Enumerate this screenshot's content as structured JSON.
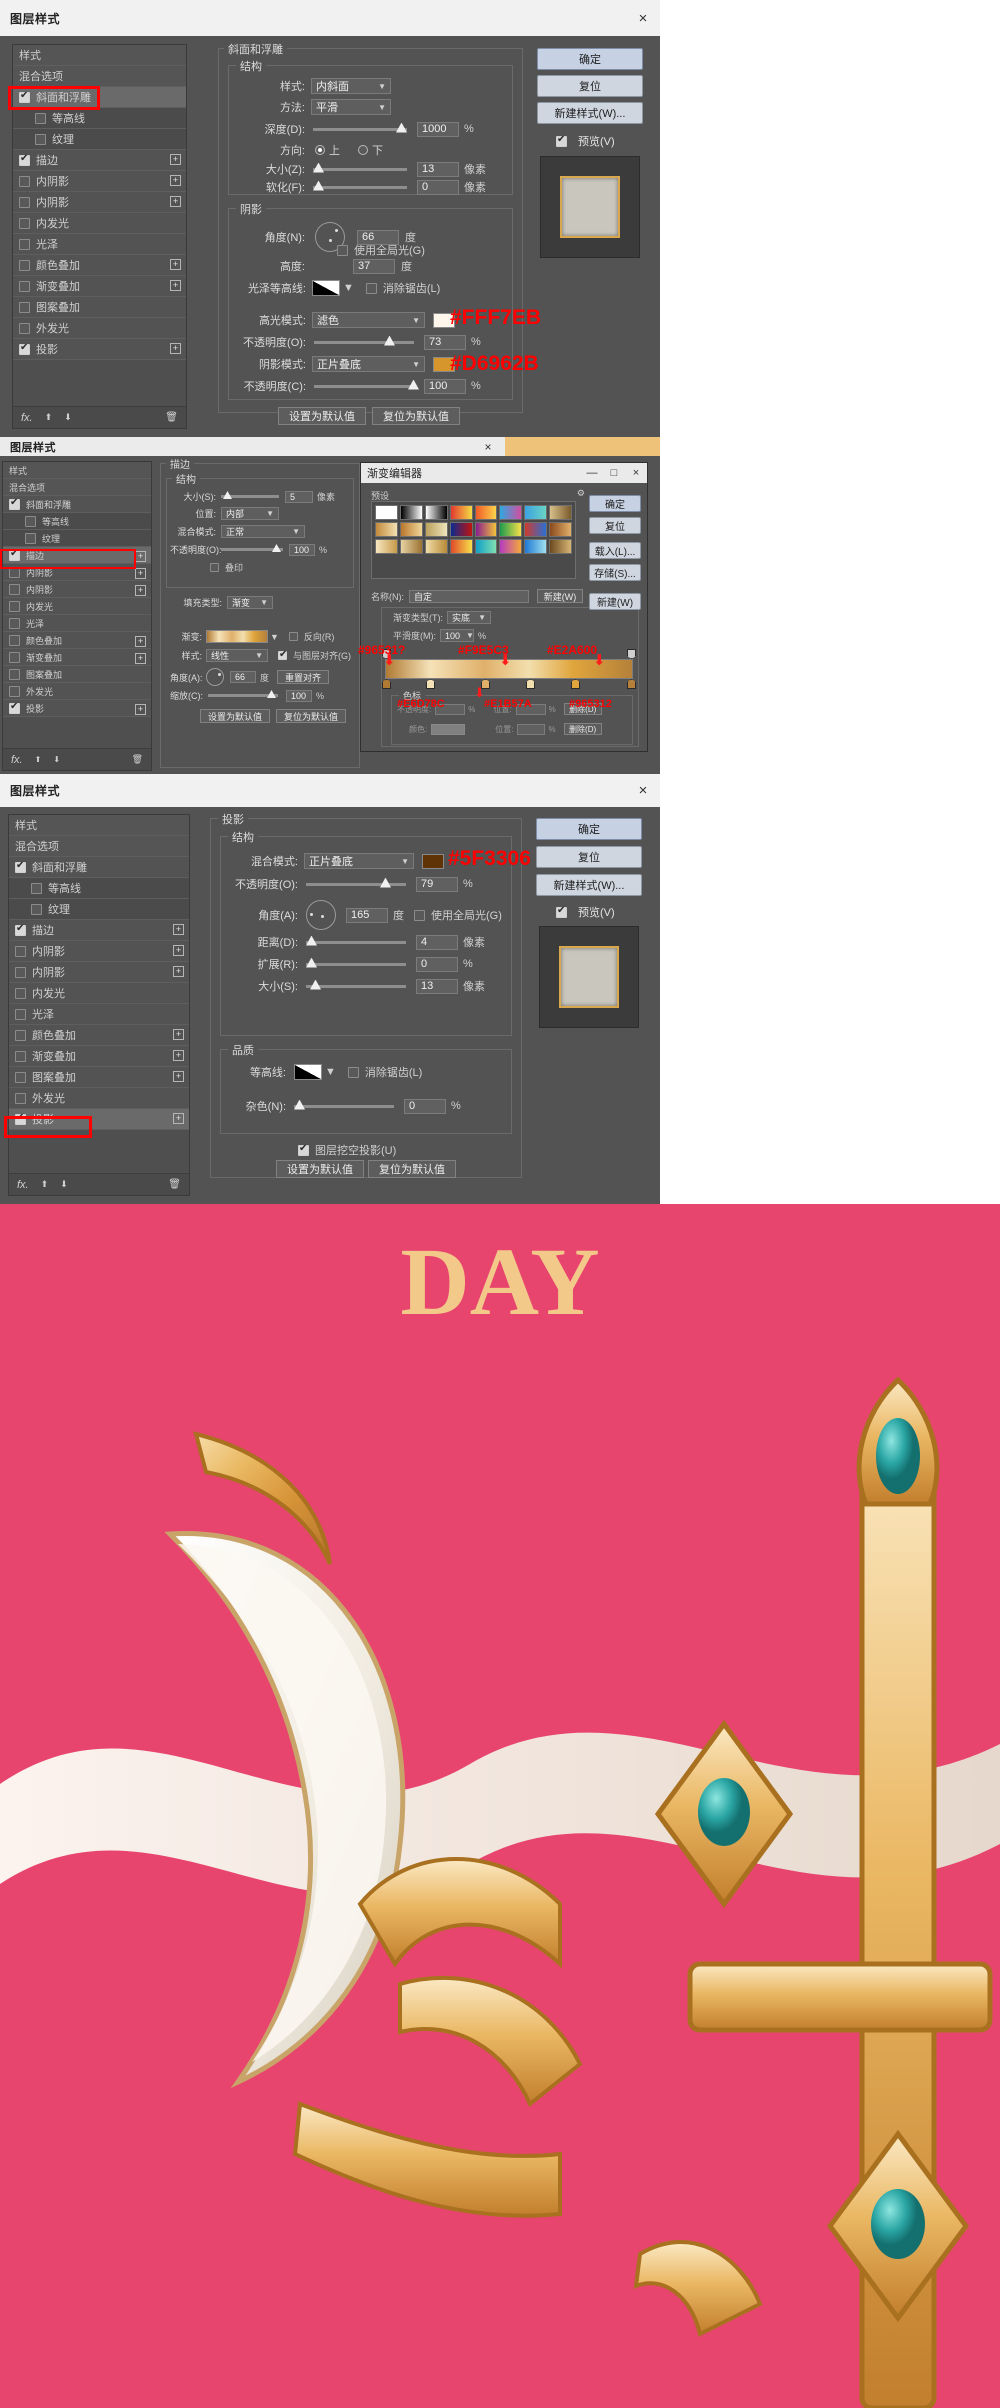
{
  "panel1": {
    "title": "图层样式",
    "close_icon": "×",
    "styles_list": [
      {
        "label": "样式",
        "checkbox": null,
        "plus": false,
        "sub": false,
        "selected": false
      },
      {
        "label": "混合选项",
        "checkbox": null,
        "plus": false,
        "sub": false,
        "selected": false
      },
      {
        "label": "斜面和浮雕",
        "checkbox": true,
        "plus": false,
        "sub": false,
        "selected": true
      },
      {
        "label": "等高线",
        "checkbox": false,
        "plus": false,
        "sub": true,
        "selected": false
      },
      {
        "label": "纹理",
        "checkbox": false,
        "plus": false,
        "sub": true,
        "selected": false
      },
      {
        "label": "描边",
        "checkbox": true,
        "plus": true,
        "sub": false,
        "selected": false
      },
      {
        "label": "内阴影",
        "checkbox": false,
        "plus": true,
        "sub": false,
        "selected": false
      },
      {
        "label": "内阴影",
        "checkbox": false,
        "plus": true,
        "sub": false,
        "selected": false
      },
      {
        "label": "内发光",
        "checkbox": false,
        "plus": false,
        "sub": false,
        "selected": false
      },
      {
        "label": "光泽",
        "checkbox": false,
        "plus": false,
        "sub": false,
        "selected": false
      },
      {
        "label": "颜色叠加",
        "checkbox": false,
        "plus": true,
        "sub": false,
        "selected": false
      },
      {
        "label": "渐变叠加",
        "checkbox": false,
        "plus": true,
        "sub": false,
        "selected": false
      },
      {
        "label": "图案叠加",
        "checkbox": false,
        "plus": false,
        "sub": false,
        "selected": false
      },
      {
        "label": "外发光",
        "checkbox": false,
        "plus": false,
        "sub": false,
        "selected": false
      },
      {
        "label": "投影",
        "checkbox": true,
        "plus": true,
        "sub": false,
        "selected": false
      }
    ],
    "fx_bar": {
      "fx": "fx.",
      "up": "⬆",
      "down": "⬇",
      "trash": "🗑"
    },
    "section_title": "斜面和浮雕",
    "structure": {
      "legend": "结构",
      "style_label": "样式:",
      "style_value": "内斜面",
      "method_label": "方法:",
      "method_value": "平滑",
      "depth_label": "深度(D):",
      "depth_value": "1000",
      "depth_unit": "%",
      "direction_label": "方向:",
      "direction_up": "上",
      "direction_down": "下",
      "direction_selected": "上",
      "size_label": "大小(Z):",
      "size_value": "13",
      "size_unit": "像素",
      "soften_label": "软化(F):",
      "soften_value": "0",
      "soften_unit": "像素"
    },
    "shading": {
      "legend": "阴影",
      "angle_label": "角度(N):",
      "angle_value": "66",
      "angle_unit": "度",
      "global_light_label": "使用全局光(G)",
      "global_light_checked": false,
      "altitude_label": "高度:",
      "altitude_value": "37",
      "altitude_unit": "度",
      "gloss_contour_label": "光泽等高线:",
      "antialias_label": "消除锯齿(L)",
      "antialias_checked": false,
      "highlight_mode_label": "高光模式:",
      "highlight_mode_value": "滤色",
      "highlight_color": "#FFF7EB",
      "highlight_opacity_label": "不透明度(O):",
      "highlight_opacity_value": "73",
      "highlight_opacity_unit": "%",
      "shadow_mode_label": "阴影模式:",
      "shadow_mode_value": "正片叠底",
      "shadow_color": "#D6962B",
      "shadow_opacity_label": "不透明度(C):",
      "shadow_opacity_value": "100",
      "shadow_opacity_unit": "%"
    },
    "footer": {
      "set_default": "设置为默认值",
      "reset_default": "复位为默认值"
    },
    "buttons": {
      "ok": "确定",
      "reset": "复位",
      "new_style": "新建样式(W)...",
      "preview": "预览(V)",
      "preview_checked": true
    },
    "annotations": [
      {
        "text": "#FFF7EB",
        "color": "#ff0000"
      },
      {
        "text": "#D6962B",
        "color": "#ff0000"
      }
    ]
  },
  "panel2": {
    "title": "图层样式",
    "close_icon": "×",
    "styles_list": [
      {
        "label": "样式",
        "checkbox": null,
        "plus": false,
        "sub": false,
        "selected": false
      },
      {
        "label": "混合选项",
        "checkbox": null,
        "plus": false,
        "sub": false,
        "selected": false
      },
      {
        "label": "斜面和浮雕",
        "checkbox": true,
        "plus": false,
        "sub": false,
        "selected": false
      },
      {
        "label": "等高线",
        "checkbox": false,
        "plus": false,
        "sub": true,
        "selected": false
      },
      {
        "label": "纹理",
        "checkbox": false,
        "plus": false,
        "sub": true,
        "selected": false
      },
      {
        "label": "描边",
        "checkbox": true,
        "plus": true,
        "sub": false,
        "selected": true
      },
      {
        "label": "内阴影",
        "checkbox": false,
        "plus": true,
        "sub": false,
        "selected": false
      },
      {
        "label": "内阴影",
        "checkbox": false,
        "plus": true,
        "sub": false,
        "selected": false
      },
      {
        "label": "内发光",
        "checkbox": false,
        "plus": false,
        "sub": false,
        "selected": false
      },
      {
        "label": "光泽",
        "checkbox": false,
        "plus": false,
        "sub": false,
        "selected": false
      },
      {
        "label": "颜色叠加",
        "checkbox": false,
        "plus": true,
        "sub": false,
        "selected": false
      },
      {
        "label": "渐变叠加",
        "checkbox": false,
        "plus": true,
        "sub": false,
        "selected": false
      },
      {
        "label": "图案叠加",
        "checkbox": false,
        "plus": false,
        "sub": false,
        "selected": false
      },
      {
        "label": "外发光",
        "checkbox": false,
        "plus": false,
        "sub": false,
        "selected": false
      },
      {
        "label": "投影",
        "checkbox": true,
        "plus": true,
        "sub": false,
        "selected": false
      }
    ],
    "section_title": "描边",
    "structure": {
      "legend": "结构",
      "size_label": "大小(S):",
      "size_value": "5",
      "size_unit": "像素",
      "position_label": "位置:",
      "position_value": "内部",
      "blend_label": "混合模式:",
      "blend_value": "正常",
      "opacity_label": "不透明度(O):",
      "opacity_value": "100",
      "opacity_unit": "%",
      "overprint_label": "叠印",
      "overprint_checked": false
    },
    "fill": {
      "fill_type_label": "填充类型:",
      "fill_type_value": "渐变",
      "gradient_label": "渐变:",
      "reverse_label": "反向(R)",
      "reverse_checked": false,
      "style_label": "样式:",
      "style_value": "线性",
      "align_layer_label": "与图层对齐(G)",
      "align_layer_checked": true,
      "angle_label": "角度(A):",
      "angle_value": "66",
      "angle_unit": "度",
      "reset_align_label": "重置对齐",
      "scale_label": "缩放(C):",
      "scale_value": "100",
      "scale_unit": "%"
    },
    "footer": {
      "set_default": "设置为默认值",
      "reset_default": "复位为默认值"
    }
  },
  "gradient_editor": {
    "title": "渐变编辑器",
    "min_icon": "—",
    "max_icon": "□",
    "close_icon": "×",
    "presets_label": "预设",
    "gear_icon": "⚙",
    "name_label": "名称(N):",
    "name_value": "自定",
    "gradient_type_label": "渐变类型(T):",
    "gradient_type_value": "实底",
    "smoothness_label": "平滑度(M):",
    "smoothness_value": "100",
    "smoothness_unit": "%",
    "stops_legend": "色标",
    "opacity_label": "不透明度:",
    "opacity_unit": "%",
    "location_label": "位置:",
    "location_unit": "%",
    "color_label": "颜色:",
    "delete_label": "删除(D)",
    "buttons": {
      "ok": "确定",
      "reset": "复位",
      "load": "载入(L)...",
      "save": "存储(S)...",
      "new": "新建(W)"
    },
    "top_annotations": [
      {
        "text": "#96531?"
      },
      {
        "text": "#F9E5C3"
      },
      {
        "text": "#E2A600"
      }
    ],
    "bottom_annotations": [
      {
        "text": "#E6D78C"
      },
      {
        "text": "#E1B57A"
      },
      {
        "text": "#965312"
      }
    ],
    "gradient_stops": [
      {
        "pos": 0,
        "color": "#b07a33"
      },
      {
        "pos": 18,
        "color": "#f5e2b8"
      },
      {
        "pos": 40,
        "color": "#e0b06a"
      },
      {
        "pos": 58,
        "color": "#f2dfae"
      },
      {
        "pos": 76,
        "color": "#e0a53c"
      },
      {
        "pos": 100,
        "color": "#b5813a"
      }
    ]
  },
  "panel3": {
    "title": "图层样式",
    "close_icon": "×",
    "styles_list": [
      {
        "label": "样式",
        "checkbox": null,
        "plus": false,
        "sub": false,
        "selected": false
      },
      {
        "label": "混合选项",
        "checkbox": null,
        "plus": false,
        "sub": false,
        "selected": false
      },
      {
        "label": "斜面和浮雕",
        "checkbox": true,
        "plus": false,
        "sub": false,
        "selected": false
      },
      {
        "label": "等高线",
        "checkbox": false,
        "plus": false,
        "sub": true,
        "selected": false
      },
      {
        "label": "纹理",
        "checkbox": false,
        "plus": false,
        "sub": true,
        "selected": false
      },
      {
        "label": "描边",
        "checkbox": true,
        "plus": true,
        "sub": false,
        "selected": false
      },
      {
        "label": "内阴影",
        "checkbox": false,
        "plus": true,
        "sub": false,
        "selected": false
      },
      {
        "label": "内阴影",
        "checkbox": false,
        "plus": true,
        "sub": false,
        "selected": false
      },
      {
        "label": "内发光",
        "checkbox": false,
        "plus": false,
        "sub": false,
        "selected": false
      },
      {
        "label": "光泽",
        "checkbox": false,
        "plus": false,
        "sub": false,
        "selected": false
      },
      {
        "label": "颜色叠加",
        "checkbox": false,
        "plus": true,
        "sub": false,
        "selected": false
      },
      {
        "label": "渐变叠加",
        "checkbox": false,
        "plus": true,
        "sub": false,
        "selected": false
      },
      {
        "label": "图案叠加",
        "checkbox": false,
        "plus": true,
        "sub": false,
        "selected": false
      },
      {
        "label": "外发光",
        "checkbox": false,
        "plus": false,
        "sub": false,
        "selected": false
      },
      {
        "label": "投影",
        "checkbox": true,
        "plus": true,
        "sub": false,
        "selected": true
      }
    ],
    "section_title": "投影",
    "structure": {
      "legend": "结构",
      "blend_label": "混合模式:",
      "blend_value": "正片叠底",
      "blend_color": "#5F3306",
      "opacity_label": "不透明度(O):",
      "opacity_value": "79",
      "opacity_unit": "%",
      "angle_label": "角度(A):",
      "angle_value": "165",
      "angle_unit": "度",
      "global_light_label": "使用全局光(G)",
      "global_light_checked": false,
      "distance_label": "距离(D):",
      "distance_value": "4",
      "distance_unit": "像素",
      "spread_label": "扩展(R):",
      "spread_value": "0",
      "spread_unit": "%",
      "size_label": "大小(S):",
      "size_value": "13",
      "size_unit": "像素"
    },
    "quality": {
      "legend": "品质",
      "contour_label": "等高线:",
      "antialias_label": "消除锯齿(L)",
      "antialias_checked": false,
      "noise_label": "杂色(N):",
      "noise_value": "0",
      "noise_unit": "%",
      "knockout_label": "图层挖空投影(U)",
      "knockout_checked": true
    },
    "footer": {
      "set_default": "设置为默认值",
      "reset_default": "复位为默认值"
    },
    "buttons": {
      "ok": "确定",
      "reset": "复位",
      "new_style": "新建样式(W)...",
      "preview": "预览(V)",
      "preview_checked": true
    },
    "annotations": [
      {
        "text": "#5F3306",
        "color": "#ff0000"
      }
    ]
  },
  "artwork": {
    "background_color": "#e8456e",
    "headline": "DAY",
    "headline_color": "#f3c98a"
  }
}
